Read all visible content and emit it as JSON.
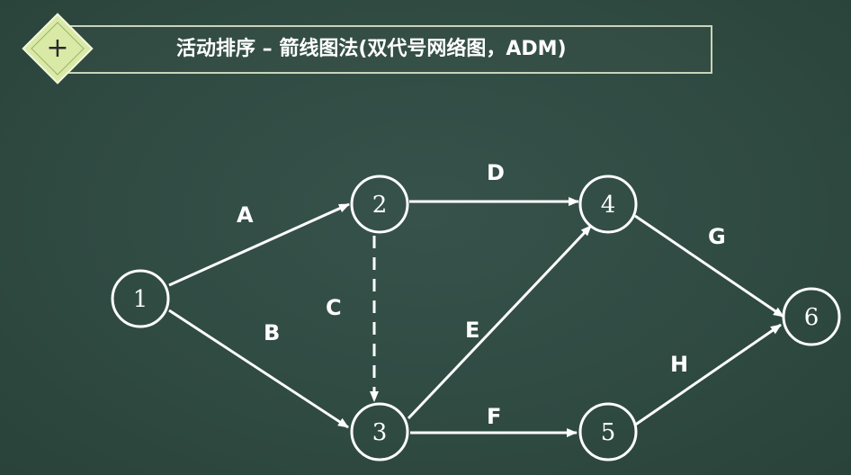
{
  "header": {
    "badge_symbol": "+",
    "title": "活动排序 – 箭线图法(双代号网络图，ADM)"
  },
  "colors": {
    "board": "#2f4a41",
    "chalk": "#ffffff",
    "badge_fill": "#d9eaa6",
    "frame": "#c9d4bb"
  },
  "diagram": {
    "nodes": [
      {
        "id": "n1",
        "label": "1"
      },
      {
        "id": "n2",
        "label": "2"
      },
      {
        "id": "n3",
        "label": "3"
      },
      {
        "id": "n4",
        "label": "4"
      },
      {
        "id": "n5",
        "label": "5"
      },
      {
        "id": "n6",
        "label": "6"
      }
    ],
    "edges": [
      {
        "label": "A",
        "from": "n1",
        "to": "n2",
        "dashed": false
      },
      {
        "label": "B",
        "from": "n1",
        "to": "n3",
        "dashed": false
      },
      {
        "label": "C",
        "from": "n2",
        "to": "n3",
        "dashed": true
      },
      {
        "label": "D",
        "from": "n2",
        "to": "n4",
        "dashed": false
      },
      {
        "label": "E",
        "from": "n3",
        "to": "n4",
        "dashed": false
      },
      {
        "label": "F",
        "from": "n3",
        "to": "n5",
        "dashed": false
      },
      {
        "label": "G",
        "from": "n4",
        "to": "n6",
        "dashed": false
      },
      {
        "label": "H",
        "from": "n5",
        "to": "n6",
        "dashed": false
      }
    ]
  }
}
